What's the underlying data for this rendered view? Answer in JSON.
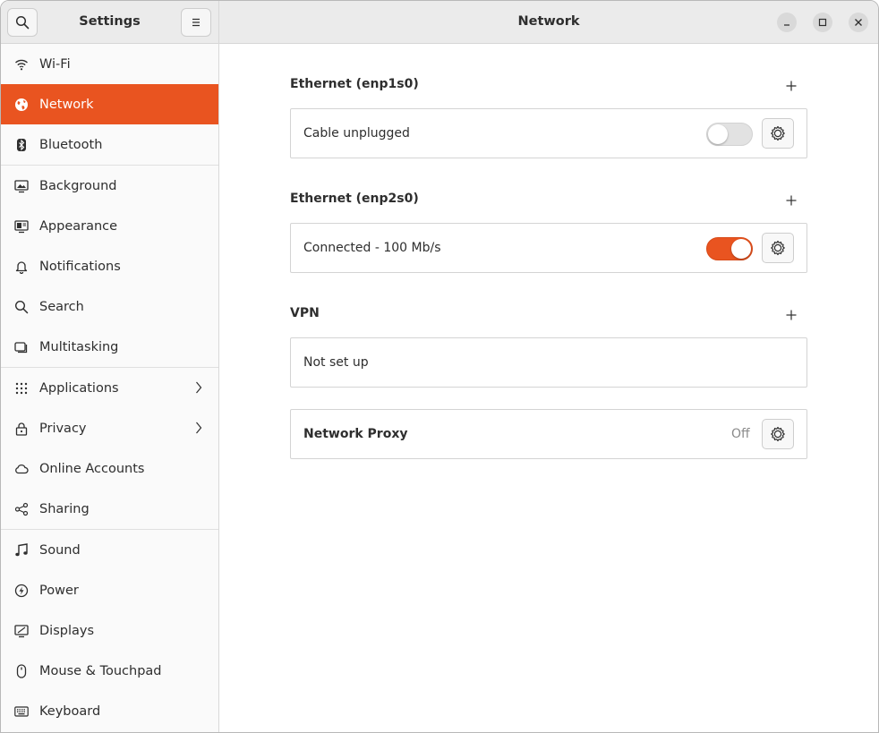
{
  "sidebar": {
    "title": "Settings",
    "search_icon": "search-icon",
    "menu_icon": "hamburger-menu-icon",
    "items": [
      {
        "label": "Wi-Fi",
        "icon": "wifi-icon"
      },
      {
        "label": "Network",
        "icon": "network-globe-icon",
        "active": true
      },
      {
        "label": "Bluetooth",
        "icon": "bluetooth-icon"
      },
      {
        "label": "Background",
        "icon": "background-monitor-icon"
      },
      {
        "label": "Appearance",
        "icon": "appearance-icon"
      },
      {
        "label": "Notifications",
        "icon": "bell-icon"
      },
      {
        "label": "Search",
        "icon": "search-icon"
      },
      {
        "label": "Multitasking",
        "icon": "multitasking-icon"
      },
      {
        "label": "Applications",
        "icon": "apps-grid-icon",
        "chevron": true
      },
      {
        "label": "Privacy",
        "icon": "lock-icon",
        "chevron": true
      },
      {
        "label": "Online Accounts",
        "icon": "cloud-icon"
      },
      {
        "label": "Sharing",
        "icon": "share-icon"
      },
      {
        "label": "Sound",
        "icon": "music-note-icon"
      },
      {
        "label": "Power",
        "icon": "power-icon"
      },
      {
        "label": "Displays",
        "icon": "display-icon"
      },
      {
        "label": "Mouse & Touchpad",
        "icon": "mouse-icon"
      },
      {
        "label": "Keyboard",
        "icon": "keyboard-icon"
      }
    ]
  },
  "header": {
    "title": "Network",
    "minimize_icon": "minimize-icon",
    "maximize_icon": "maximize-icon",
    "close_icon": "close-icon"
  },
  "sections": {
    "eth1": {
      "title": "Ethernet (enp1s0)",
      "status": "Cable unplugged",
      "enabled": false
    },
    "eth2": {
      "title": "Ethernet (enp2s0)",
      "status": "Connected - 100 Mb/s",
      "enabled": true
    },
    "vpn": {
      "title": "VPN",
      "status": "Not set up"
    },
    "proxy": {
      "label": "Network Proxy",
      "status": "Off"
    }
  },
  "colors": {
    "accent": "#e95420",
    "header_bg": "#ebebeb",
    "sidebar_bg": "#fafafa"
  }
}
